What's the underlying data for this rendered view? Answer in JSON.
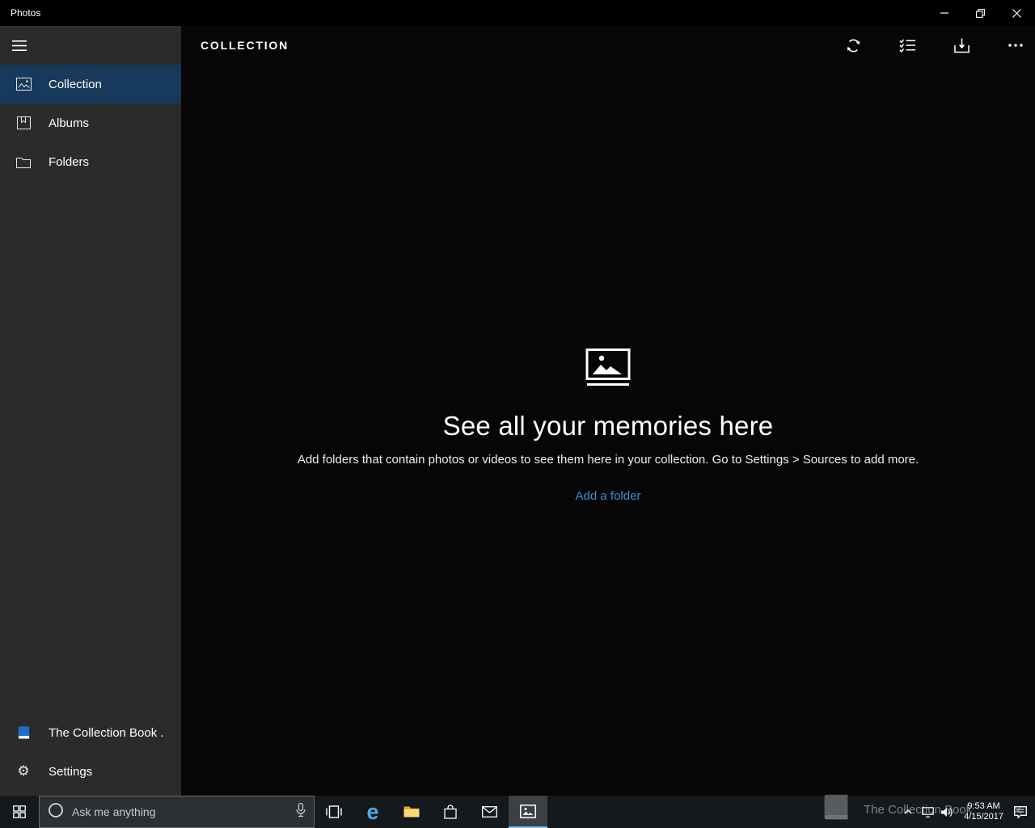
{
  "titlebar": {
    "app_title": "Photos",
    "control_icons": [
      "minimize-icon",
      "restore-icon",
      "close-icon"
    ]
  },
  "header": {
    "title": "COLLECTION",
    "action_icons": [
      "refresh-icon",
      "select-icon",
      "import-icon",
      "more-icon"
    ]
  },
  "sidebar": {
    "items": [
      {
        "label": "Collection",
        "icon": "collection-icon",
        "selected": true
      },
      {
        "label": "Albums",
        "icon": "albums-icon",
        "selected": false
      },
      {
        "label": "Folders",
        "icon": "folders-icon",
        "selected": false
      }
    ],
    "bottom_items": [
      {
        "label": "The Collection Book .",
        "icon": "book-icon"
      },
      {
        "label": "Settings",
        "icon": "gear-icon"
      }
    ]
  },
  "empty_state": {
    "icon": "photos-stack-icon",
    "title": "See all your memories here",
    "description": "Add folders that contain photos or videos to see them here in your collection. Go to Settings > Sources to add more.",
    "action_label": "Add a folder"
  },
  "taskbar": {
    "search": {
      "placeholder": "Ask me anything"
    },
    "pinned_icons": [
      "task-view-icon",
      "edge-icon",
      "file-explorer-icon",
      "store-icon",
      "mail-icon",
      "photos-icon"
    ],
    "active_app": "photos-icon",
    "tray": {
      "icons": [
        "chevron-up-icon",
        "network-icon",
        "volume-icon",
        "action-center-icon"
      ],
      "time": "9:53 AM",
      "date": "4/15/2017"
    }
  },
  "toast": {
    "icon": "book-icon",
    "title": "The Collection Book"
  },
  "glyphs": {
    "gear": "⚙",
    "edge_e": "e"
  },
  "colors": {
    "titlebar_bg": "#000000",
    "sidebar_bg": "#2b2b2b",
    "selected_item_bg": "#17395b",
    "content_bg": "#060606",
    "taskbar_bg": "#15181c",
    "link_blue": "#3a8fd0",
    "edge_blue": "#46aee9",
    "folder_yellow": "#ffc843",
    "book_blue": "#1d6fc9",
    "active_app_underline": "#76b9ed",
    "text_primary": "#ffffff"
  }
}
